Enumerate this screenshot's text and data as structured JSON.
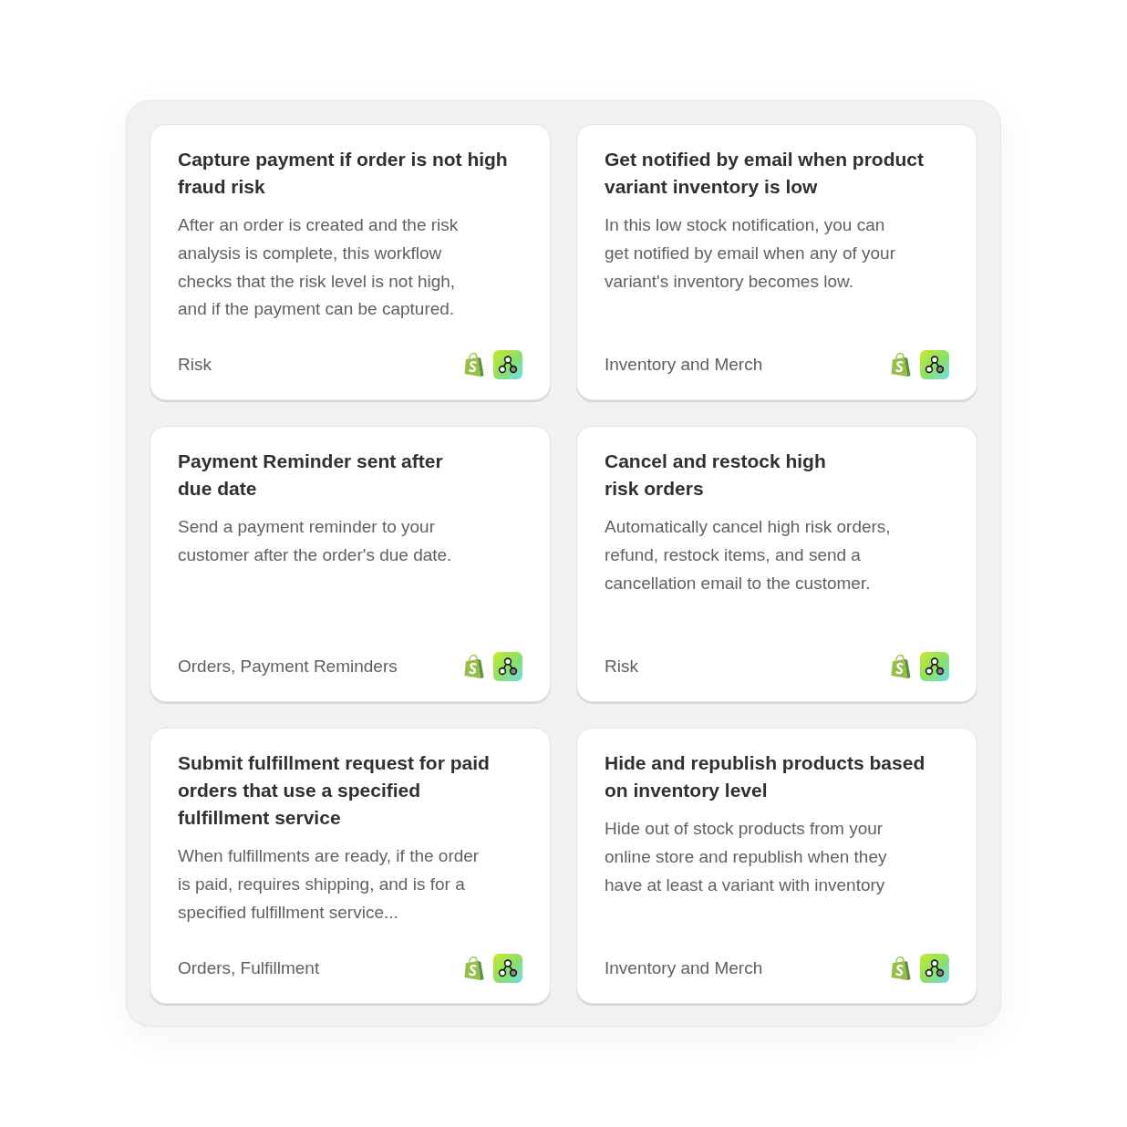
{
  "templates": [
    {
      "title": "Capture payment if order is not high\nfraud risk",
      "description": "After an order is created and the risk\nanalysis is complete, this workflow\nchecks that the risk level is not high,\nand if the payment can be captured.",
      "category": "Risk"
    },
    {
      "title": "Get notified by email when product\nvariant inventory is low",
      "description": "In this low stock notification, you can\nget notified by email when any of your\nvariant's inventory becomes low.",
      "category": "Inventory and Merch"
    },
    {
      "title": "Payment Reminder sent after\ndue date",
      "description": "Send a payment reminder to your\ncustomer after the order's due date.",
      "category": "Orders, Payment Reminders"
    },
    {
      "title": "Cancel and restock high\nrisk orders",
      "description": "Automatically cancel high risk orders,\nrefund, restock items, and send a\ncancellation email to the customer.",
      "category": "Risk"
    },
    {
      "title": "Submit fulfillment request for paid\norders that use a specified\nfulfillment service",
      "description": "When fulfillments are ready, if the order\nis paid, requires shipping, and is for a\nspecified fulfillment service...",
      "category": "Orders, Fulfillment"
    },
    {
      "title": "Hide and republish products based\non inventory level",
      "description": "Hide out of stock products from your\nonline store and republish when they\nhave at least a variant with inventory",
      "category": "Inventory and Merch"
    }
  ]
}
